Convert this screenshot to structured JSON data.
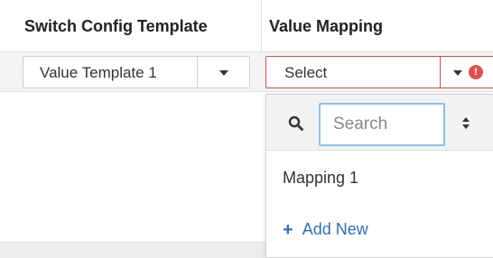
{
  "table": {
    "headers": [
      "Switch Config Template",
      "Value Mapping"
    ],
    "row": {
      "template_select": {
        "value": "Value Template 1",
        "icon": "chevron-down-icon"
      },
      "mapping_select": {
        "value": "Select",
        "icon": "chevron-down-icon",
        "error_icon": "error-icon",
        "error_glyph": "!",
        "border_color": "#c75050"
      }
    }
  },
  "dropdown": {
    "search": {
      "placeholder": "Search",
      "icon": "search-icon",
      "sort_icon": "sort-icon"
    },
    "options": [
      "Mapping 1"
    ],
    "add_new": {
      "plus": "+",
      "label": "Add New",
      "color": "#2f6fad"
    }
  }
}
